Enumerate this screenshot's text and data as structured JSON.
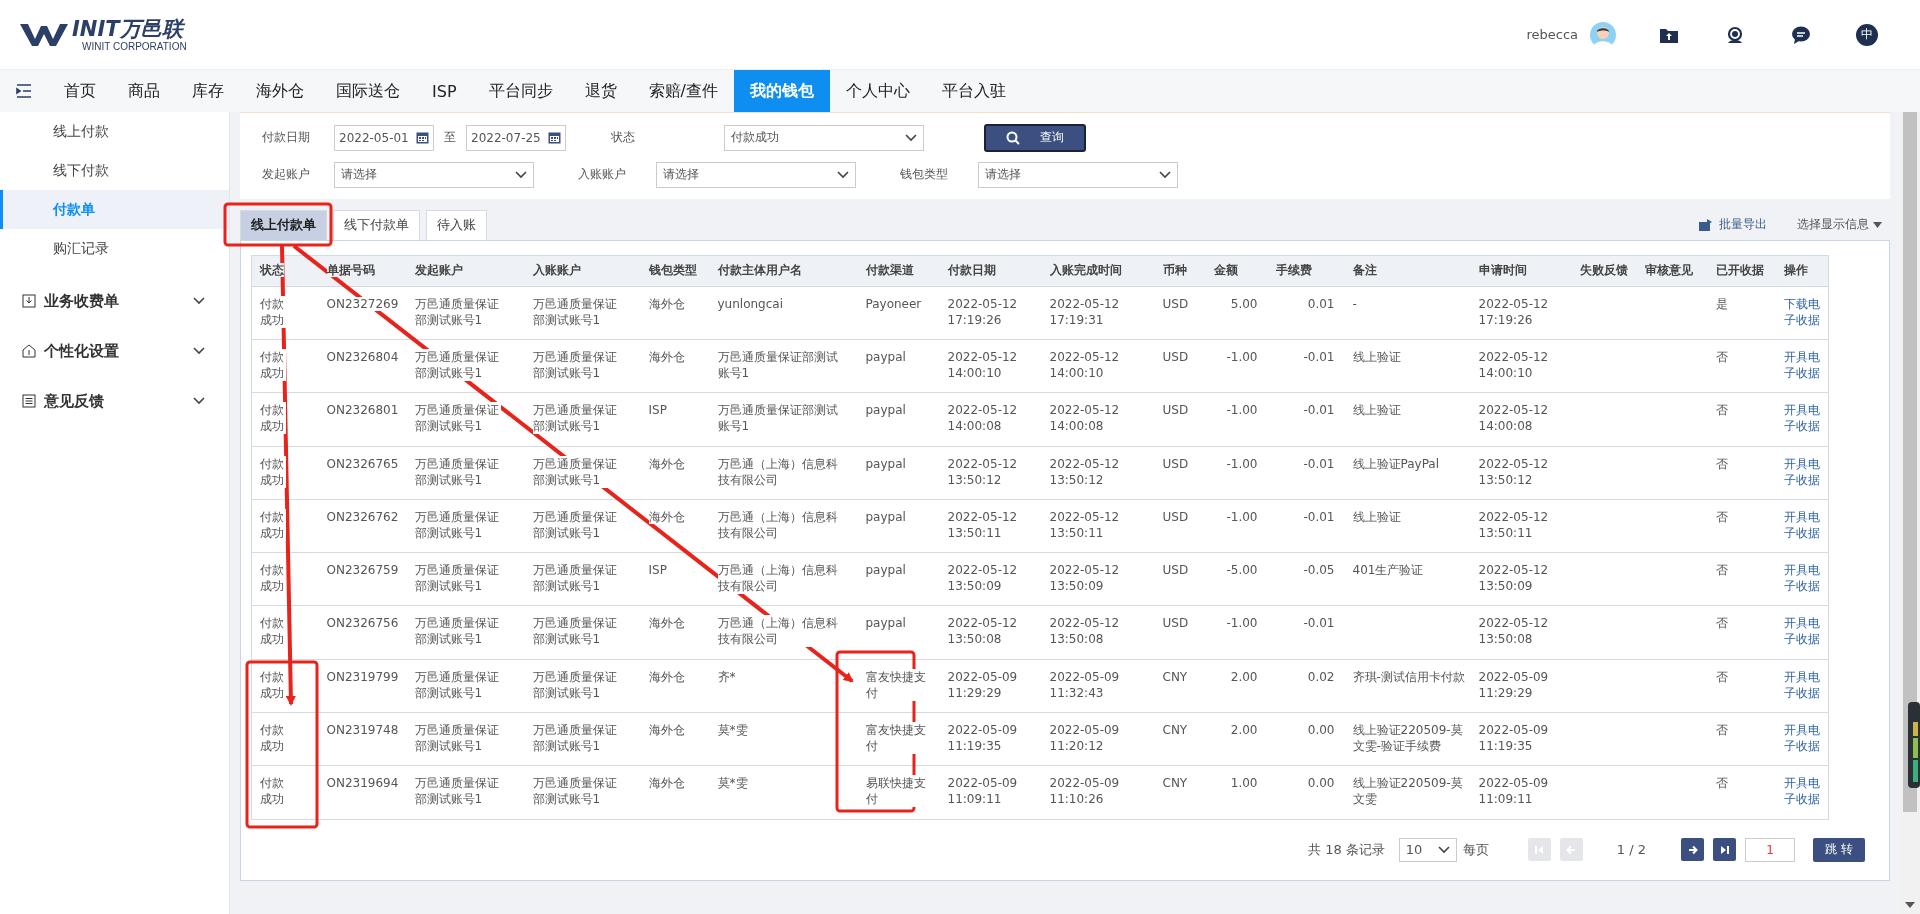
{
  "header": {
    "logo_text": "INIT万邑联",
    "logo_subtitle": "WINIT CORPORATION",
    "user": "rebecca",
    "language": "中"
  },
  "nav": [
    {
      "label": "首页",
      "selected": false
    },
    {
      "label": "商品",
      "selected": false
    },
    {
      "label": "库存",
      "selected": false
    },
    {
      "label": "海外仓",
      "selected": false
    },
    {
      "label": "国际送仓",
      "selected": false
    },
    {
      "label": "ISP",
      "selected": false
    },
    {
      "label": "平台同步",
      "selected": false
    },
    {
      "label": "退货",
      "selected": false
    },
    {
      "label": "索赔/查件",
      "selected": false
    },
    {
      "label": "我的钱包",
      "selected": true
    },
    {
      "label": "个人中心",
      "selected": false
    },
    {
      "label": "平台入驻",
      "selected": false
    }
  ],
  "sidebar": {
    "items": [
      {
        "label": "线上付款",
        "selected": false
      },
      {
        "label": "线下付款",
        "selected": false
      },
      {
        "label": "付款单",
        "selected": true
      },
      {
        "label": "购汇记录",
        "selected": false
      }
    ],
    "groups": [
      {
        "label": "业务收费单",
        "expanded": false
      },
      {
        "label": "个性化设置",
        "expanded": false
      },
      {
        "label": "意见反馈",
        "expanded": false
      }
    ]
  },
  "filters": {
    "date_label": "付款日期",
    "date_from": "2022-05-01",
    "date_sep": "至",
    "date_to": "2022-07-25",
    "status_label": "状态",
    "status_value": "付款成功",
    "search_button": "查询",
    "selects": [
      {
        "label": "发起账户",
        "placeholder": "请选择"
      },
      {
        "label": "入账账户",
        "placeholder": "请选择"
      },
      {
        "label": "钱包类型",
        "placeholder": "请选择"
      }
    ]
  },
  "tabs": [
    {
      "label": "线上付款单",
      "selected": true
    },
    {
      "label": "线下付款单",
      "selected": false
    },
    {
      "label": "待入账",
      "selected": false
    }
  ],
  "toolbar": {
    "export": "批量导出",
    "display": "选择显示信息"
  },
  "table": {
    "columns": [
      "状态",
      "单据号码",
      "发起账户",
      "入账账户",
      "钱包类型",
      "付款主体用户名",
      "付款渠道",
      "付款日期",
      "入账完成时间",
      "币种",
      "金额",
      "手续费",
      "备注",
      "申请时间",
      "失败反馈",
      "审核意见",
      "已开收据",
      "操作"
    ],
    "rows": [
      {
        "status": "付款成功",
        "number": "ON2327269",
        "from": "万邑通质量保证部测试账号1",
        "to": "万邑通质量保证部测试账号1",
        "wallet": "海外仓",
        "payer": "yunlongcai",
        "channel": "Payoneer",
        "pay_date": "2022-05-12 17:19:26",
        "done_time": "2022-05-12 17:19:31",
        "currency": "USD",
        "amount": "5.00",
        "fee": "0.01",
        "note": "-",
        "apply_time": "2022-05-12 17:19:26",
        "receipt": "是",
        "action": "下载电子收据"
      },
      {
        "status": "付款成功",
        "number": "ON2326804",
        "from": "万邑通质量保证部测试账号1",
        "to": "万邑通质量保证部测试账号1",
        "wallet": "海外仓",
        "payer": "万邑通质量保证部测试账号1",
        "channel": "paypal",
        "pay_date": "2022-05-12 14:00:10",
        "done_time": "2022-05-12 14:00:10",
        "currency": "USD",
        "amount": "-1.00",
        "fee": "-0.01",
        "note": "线上验证",
        "apply_time": "2022-05-12 14:00:10",
        "receipt": "否",
        "action": "开具电子收据"
      },
      {
        "status": "付款成功",
        "number": "ON2326801",
        "from": "万邑通质量保证部测试账号1",
        "to": "万邑通质量保证部测试账号1",
        "wallet": "ISP",
        "payer": "万邑通质量保证部测试账号1",
        "channel": "paypal",
        "pay_date": "2022-05-12 14:00:08",
        "done_time": "2022-05-12 14:00:08",
        "currency": "USD",
        "amount": "-1.00",
        "fee": "-0.01",
        "note": "线上验证",
        "apply_time": "2022-05-12 14:00:08",
        "receipt": "否",
        "action": "开具电子收据"
      },
      {
        "status": "付款成功",
        "number": "ON2326765",
        "from": "万邑通质量保证部测试账号1",
        "to": "万邑通质量保证部测试账号1",
        "wallet": "海外仓",
        "payer": "万邑通（上海）信息科技有限公司",
        "channel": "paypal",
        "pay_date": "2022-05-12 13:50:12",
        "done_time": "2022-05-12 13:50:12",
        "currency": "USD",
        "amount": "-1.00",
        "fee": "-0.01",
        "note": "线上验证PayPal",
        "apply_time": "2022-05-12 13:50:12",
        "receipt": "否",
        "action": "开具电子收据"
      },
      {
        "status": "付款成功",
        "number": "ON2326762",
        "from": "万邑通质量保证部测试账号1",
        "to": "万邑通质量保证部测试账号1",
        "wallet": "海外仓",
        "payer": "万邑通（上海）信息科技有限公司",
        "channel": "paypal",
        "pay_date": "2022-05-12 13:50:11",
        "done_time": "2022-05-12 13:50:11",
        "currency": "USD",
        "amount": "-1.00",
        "fee": "-0.01",
        "note": "线上验证",
        "apply_time": "2022-05-12 13:50:11",
        "receipt": "否",
        "action": "开具电子收据"
      },
      {
        "status": "付款成功",
        "number": "ON2326759",
        "from": "万邑通质量保证部测试账号1",
        "to": "万邑通质量保证部测试账号1",
        "wallet": "ISP",
        "payer": "万邑通（上海）信息科技有限公司",
        "channel": "paypal",
        "pay_date": "2022-05-12 13:50:09",
        "done_time": "2022-05-12 13:50:09",
        "currency": "USD",
        "amount": "-5.00",
        "fee": "-0.05",
        "note": "401生产验证",
        "apply_time": "2022-05-12 13:50:09",
        "receipt": "否",
        "action": "开具电子收据"
      },
      {
        "status": "付款成功",
        "number": "ON2326756",
        "from": "万邑通质量保证部测试账号1",
        "to": "万邑通质量保证部测试账号1",
        "wallet": "海外仓",
        "payer": "万邑通（上海）信息科技有限公司",
        "channel": "paypal",
        "pay_date": "2022-05-12 13:50:08",
        "done_time": "2022-05-12 13:50:08",
        "currency": "USD",
        "amount": "-1.00",
        "fee": "-0.01",
        "apply_time": "2022-05-12 13:50:08",
        "receipt": "否",
        "action": "开具电子收据"
      },
      {
        "status": "付款成功",
        "number": "ON2319799",
        "from": "万邑通质量保证部测试账号1",
        "to": "万邑通质量保证部测试账号1",
        "wallet": "海外仓",
        "payer": "齐*",
        "channel": "富友快捷支付",
        "pay_date": "2022-05-09 11:29:29",
        "done_time": "2022-05-09 11:32:43",
        "currency": "CNY",
        "amount": "2.00",
        "fee": "0.02",
        "note": "齐琪-测试信用卡付款",
        "apply_time": "2022-05-09 11:29:29",
        "receipt": "否",
        "action": "开具电子收据"
      },
      {
        "status": "付款成功",
        "number": "ON2319748",
        "from": "万邑通质量保证部测试账号1",
        "to": "万邑通质量保证部测试账号1",
        "wallet": "海外仓",
        "payer": "莫*雯",
        "channel": "富友快捷支付",
        "pay_date": "2022-05-09 11:19:35",
        "done_time": "2022-05-09 11:20:12",
        "currency": "CNY",
        "amount": "2.00",
        "fee": "0.00",
        "note": "线上验证220509-莫文雯-验证手续费",
        "apply_time": "2022-05-09 11:19:35",
        "receipt": "否",
        "action": "开具电子收据"
      },
      {
        "status": "付款成功",
        "number": "ON2319694",
        "from": "万邑通质量保证部测试账号1",
        "to": "万邑通质量保证部测试账号1",
        "wallet": "海外仓",
        "payer": "莫*雯",
        "channel": "易联快捷支付",
        "pay_date": "2022-05-09 11:09:11",
        "done_time": "2022-05-09 11:10:26",
        "currency": "CNY",
        "amount": "1.00",
        "fee": "0.00",
        "note": "线上验证220509-莫文雯",
        "apply_time": "2022-05-09 11:09:11",
        "receipt": "否",
        "action": "开具电子收据"
      }
    ]
  },
  "pagination": {
    "total": "共 18 条记录",
    "page_size": "10",
    "per_page": "每页",
    "page": "1 / 2",
    "first_disabled": true,
    "prev_disabled": true,
    "next_disabled": false,
    "last_disabled": false,
    "jump_value": "1",
    "jump_button": "跳 转"
  }
}
